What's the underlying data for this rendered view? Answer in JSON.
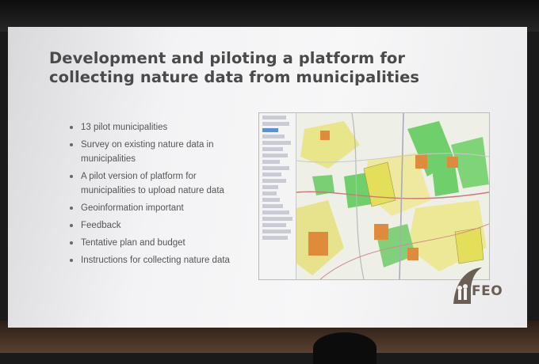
{
  "slide": {
    "title_line1": "Development and piloting a platform for",
    "title_line2": "collecting nature data from municipalities",
    "bullets": [
      "13 pilot municipalities",
      "Survey on existing nature data in municipalities",
      "A pilot version of platform for municipalities to upload nature data",
      "Geoinformation important",
      "Feedback",
      "Tentative plan and budget",
      "Instructions for collecting nature data"
    ],
    "logo_text": "FEO"
  },
  "colors": {
    "title": "#4a4a4a",
    "bullet_text": "#555555",
    "map_green": "#6fcf6a",
    "map_orange": "#e08a3c",
    "map_yellow": "#e4df5a",
    "logo": "#6b5e55"
  }
}
